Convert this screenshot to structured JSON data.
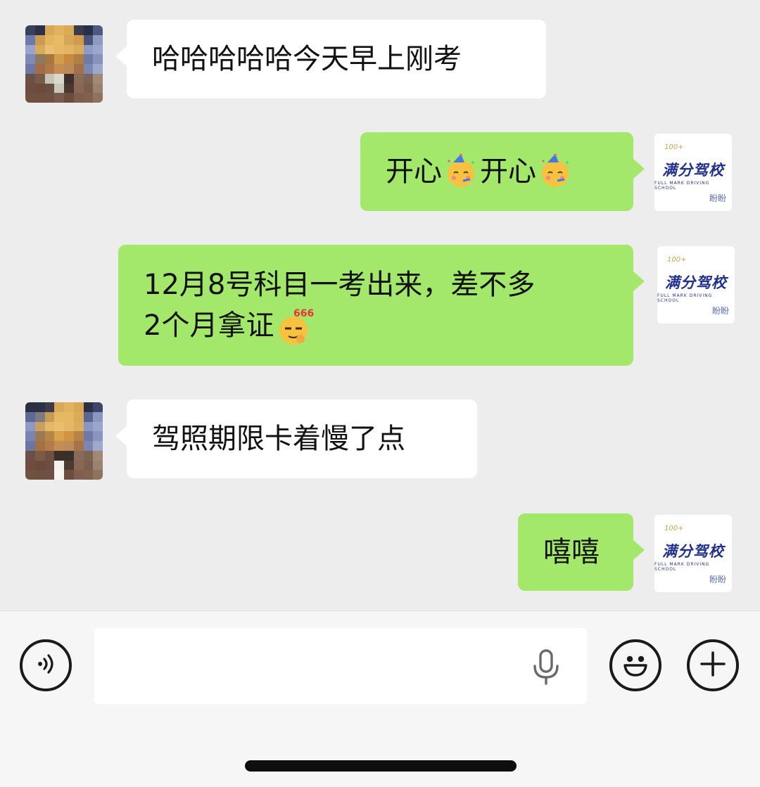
{
  "contact": {
    "avatar_name": "contact-avatar"
  },
  "school": {
    "brand": "满分驾校",
    "brand_en": "FULL MARK DRIVING SCHOOL",
    "badge": "100+",
    "owner": "盼盼",
    "brand_color": "#21308f"
  },
  "messages": [
    {
      "side": "left",
      "text": "哈哈哈哈哈今天早上刚考"
    },
    {
      "side": "right",
      "parts": [
        "开心",
        "开心"
      ],
      "emoji": "partying-face"
    },
    {
      "side": "right",
      "line1": "12月8号科目一考出来，差不多",
      "line2": "2个月拿证",
      "emoji": "666-face"
    },
    {
      "side": "left",
      "text": "驾照期限卡着慢了点"
    },
    {
      "side": "right",
      "text": "嘻嘻"
    }
  ],
  "input_bar": {
    "voice_icon": "voice-icon",
    "mic_icon": "microphone-icon",
    "emoji_icon": "smiley-icon",
    "plus_icon": "plus-icon",
    "value": ""
  },
  "colors": {
    "background": "#ededed",
    "sent_bubble": "#a3e76b",
    "received_bubble": "#ffffff"
  }
}
